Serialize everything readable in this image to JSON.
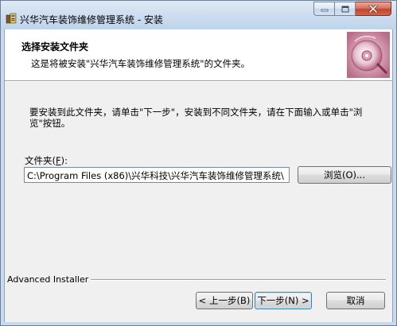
{
  "window": {
    "title": "兴华汽车装饰维修管理系统 - 安装"
  },
  "header": {
    "title": "选择安装文件夹",
    "description": "这是将被安装\"兴华汽车装饰维修管理系统\"的文件夹。"
  },
  "body": {
    "instruction": "要安装到此文件夹，请单击\"下一步\"，安装到不同文件夹，请在下面输入或单击\"浏览\"按钮。",
    "folder_label_prefix": "文件夹(",
    "folder_label_key": "F",
    "folder_label_suffix": "):",
    "folder_path": "C:\\Program Files (x86)\\兴华科技\\兴华汽车装饰维修管理系统\\",
    "browse_button": "浏览(O)..."
  },
  "footer": {
    "brand": "Advanced Installer",
    "back_button": "< 上一步(B)",
    "next_button": "下一步(N) >",
    "cancel_button": "取消"
  },
  "icons": {
    "app": "installer-icon",
    "minimize": "minimize-icon",
    "maximize": "maximize-icon",
    "close": "close-icon",
    "header_art": "installer-disc-art-icon"
  }
}
